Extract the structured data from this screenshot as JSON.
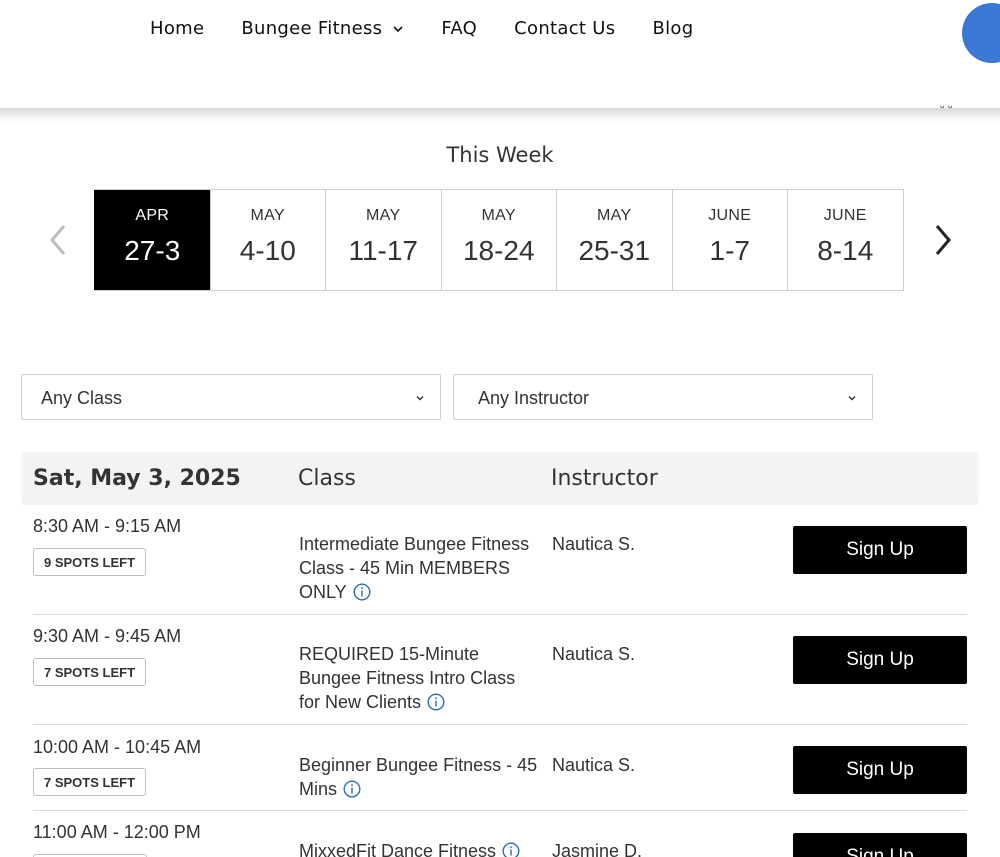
{
  "nav": {
    "items": [
      "Home",
      "Bungee Fitness",
      "FAQ",
      "Contact Us",
      "Blog"
    ],
    "dropdown_index": 1
  },
  "corner_glyph": "ᵕ ᵕ",
  "week_picker": {
    "title": "This Week",
    "weeks": [
      {
        "month": "APR",
        "range": "27-3",
        "active": true
      },
      {
        "month": "MAY",
        "range": "4-10",
        "active": false
      },
      {
        "month": "MAY",
        "range": "11-17",
        "active": false
      },
      {
        "month": "MAY",
        "range": "18-24",
        "active": false
      },
      {
        "month": "MAY",
        "range": "25-31",
        "active": false
      },
      {
        "month": "JUNE",
        "range": "1-7",
        "active": false
      },
      {
        "month": "JUNE",
        "range": "8-14",
        "active": false
      }
    ]
  },
  "filters": {
    "class_select": "Any Class",
    "instructor_select": "Any Instructor"
  },
  "schedule": {
    "date_header": "Sat, May 3, 2025",
    "class_header": "Class",
    "instructor_header": "Instructor",
    "rows": [
      {
        "time": "8:30 AM - 9:15 AM",
        "spots": "9 SPOTS LEFT",
        "class_name": "Intermediate Bungee Fitness Class - 45 Min MEMBERS ONLY",
        "instructor": "Nautica S.",
        "button": "Sign Up"
      },
      {
        "time": "9:30 AM - 9:45 AM",
        "spots": "7 SPOTS LEFT",
        "class_name": "REQUIRED 15-Minute Bungee Fitness Intro Class for New Clients",
        "instructor": "Nautica S.",
        "button": "Sign Up"
      },
      {
        "time": "10:00 AM - 10:45 AM",
        "spots": "7 SPOTS LEFT",
        "class_name": "Beginner Bungee Fitness - 45 Mins",
        "instructor": "Nautica S.",
        "button": "Sign Up"
      },
      {
        "time": "11:00 AM - 12:00 PM",
        "spots": "",
        "class_name": "MixxedFit Dance Fitness",
        "instructor": "Jasmine D.",
        "button": "Sign Up"
      }
    ]
  },
  "colors": {
    "accent_blue": "#3b78d6",
    "active_week_bg": "#000000",
    "button_bg": "#000000",
    "info_icon": "#2f6fb0"
  },
  "icons": {
    "dropdown": "chevron-down-icon",
    "prev": "chevron-left-icon",
    "next": "chevron-right-icon",
    "info": "info-circle-icon"
  }
}
